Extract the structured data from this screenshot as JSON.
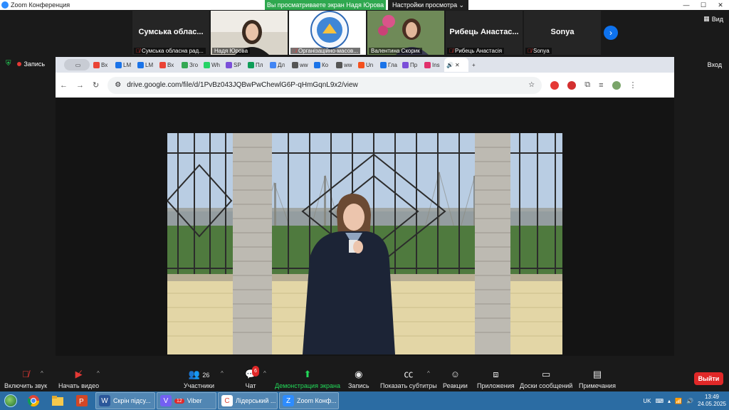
{
  "app": {
    "title": "Zoom Конференция",
    "share_banner": "Вы просматриваете экран Надя Юрова",
    "view_settings": "Настройки просмотра",
    "view_label": "Вид",
    "recording": "Запись",
    "exit_fullscreen": "Вход"
  },
  "participants": [
    {
      "big_name": "Сумська облас...",
      "caption": "Сумська обласна рад...",
      "muted": true,
      "has_photo": false
    },
    {
      "big_name": "",
      "caption": "Надя Юрова",
      "muted": false,
      "has_photo": true,
      "active": true
    },
    {
      "big_name": "",
      "caption": "Організаційно-масов...",
      "muted": true,
      "has_photo": true
    },
    {
      "big_name": "",
      "caption": "Валентина Скорик",
      "muted": false,
      "has_photo": true
    },
    {
      "big_name": "Рибець Анастас...",
      "caption": "Рибець Анастасія",
      "muted": true,
      "has_photo": false
    },
    {
      "big_name": "Sonya",
      "caption": "Sonya",
      "muted": true,
      "has_photo": false
    }
  ],
  "browser": {
    "tabs": [
      {
        "label": "Вх",
        "color": "#ea4335"
      },
      {
        "label": "LM",
        "color": "#1a73e8"
      },
      {
        "label": "LM",
        "color": "#1a73e8"
      },
      {
        "label": "Вх",
        "color": "#ea4335"
      },
      {
        "label": "Зго",
        "color": "#34a853"
      },
      {
        "label": "Wh",
        "color": "#25d366"
      },
      {
        "label": "SP",
        "color": "#7b4fd9"
      },
      {
        "label": "Пл",
        "color": "#0f9d58"
      },
      {
        "label": "Дл",
        "color": "#4285f4"
      },
      {
        "label": "ww",
        "color": "#555555"
      },
      {
        "label": "Ко",
        "color": "#1a73e8"
      },
      {
        "label": "ww",
        "color": "#555555"
      },
      {
        "label": "Un",
        "color": "#f4511e"
      },
      {
        "label": "Гла",
        "color": "#1a73e8"
      },
      {
        "label": "Пр",
        "color": "#7b4fd9"
      },
      {
        "label": "Ins",
        "color": "#e1306c"
      }
    ],
    "url": "drive.google.com/file/d/1PvBz043JQBwPwChewlG6P-qHmGqnL9x2/view"
  },
  "toolbar": {
    "unmute": "Включить звук",
    "start_video": "Начать видео",
    "participants_label": "Участники",
    "participants_count": "26",
    "chat": "Чат",
    "chat_badge": "6",
    "share_screen": "Демонстрация экрана",
    "record": "Запись",
    "subtitles": "Показать субтитры",
    "reactions": "Реакции",
    "apps": "Приложения",
    "whiteboards": "Доски сообщений",
    "notes": "Примечания",
    "leave": "Выйти"
  },
  "taskbar": {
    "tasks": [
      {
        "label": "Скрін підсу...",
        "icon": "W",
        "color": "#2b579a"
      },
      {
        "label": "Viber",
        "icon": "V",
        "color": "#7360f2",
        "badge": "12"
      },
      {
        "label": "Лідерський ...",
        "icon": "C",
        "color": "#ffffff"
      },
      {
        "label": "Zoom Конф...",
        "icon": "Z",
        "color": "#2d8cff"
      }
    ],
    "lang": "UK",
    "time": "13:49",
    "date": "24.05.2025"
  },
  "colors": {
    "accent_green": "#23d959",
    "zoom_blue": "#2d8cff",
    "leave_red": "#e02828"
  }
}
